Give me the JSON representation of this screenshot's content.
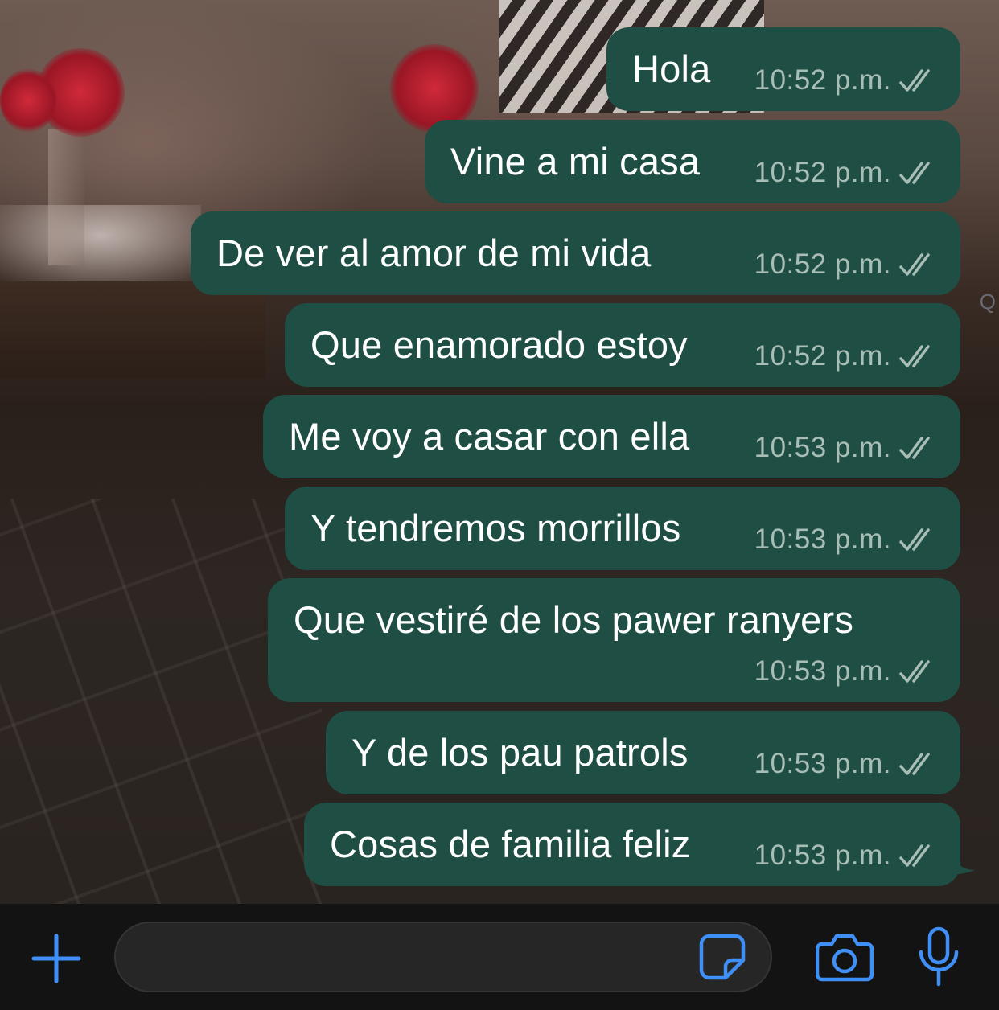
{
  "theme": {
    "bubble_color": "#1f4f44",
    "accent_color": "#3f8ff7",
    "bar_color": "#131313"
  },
  "messages": [
    {
      "text": "Hola",
      "time": "10:52 p.m.",
      "status": "read"
    },
    {
      "text": "Vine a mi casa",
      "time": "10:52 p.m.",
      "status": "read"
    },
    {
      "text": "De ver al amor de mi vida",
      "time": "10:52 p.m.",
      "status": "read"
    },
    {
      "text": "Que enamorado estoy",
      "time": "10:52 p.m.",
      "status": "read"
    },
    {
      "text": "Me voy a casar con ella",
      "time": "10:53 p.m.",
      "status": "read"
    },
    {
      "text": "Y tendremos morrillos",
      "time": "10:53 p.m.",
      "status": "read"
    },
    {
      "text": "Que vestiré de los pawer ranyers",
      "time": "10:53 p.m.",
      "status": "read"
    },
    {
      "text": "Y de los pau patrols",
      "time": "10:53 p.m.",
      "status": "read"
    },
    {
      "text": "Cosas de familia feliz",
      "time": "10:53 p.m.",
      "status": "read"
    }
  ],
  "composer": {
    "input_value": "",
    "icons": [
      "plus-icon",
      "sticker-icon",
      "camera-icon",
      "microphone-icon"
    ]
  },
  "side_glyph": "Q"
}
